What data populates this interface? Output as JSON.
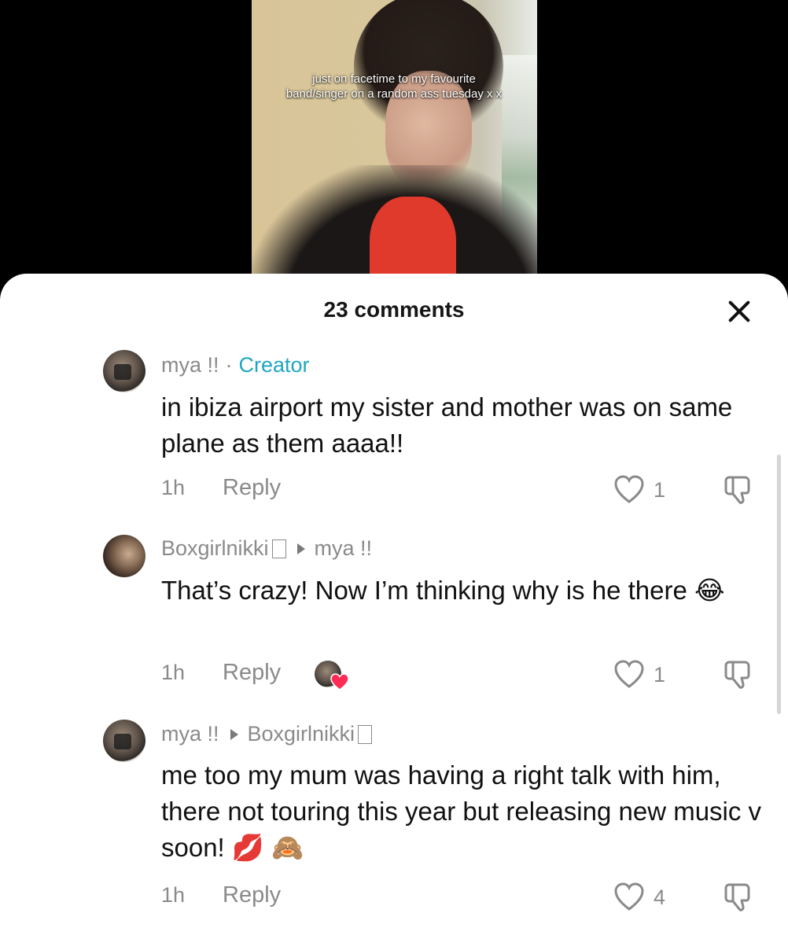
{
  "video": {
    "caption": "just on facetime to my favourite band/singer on a random ass tuesday x x"
  },
  "sheet": {
    "title": "23 comments"
  },
  "comments": [
    {
      "author": "mya !!",
      "separator": "·",
      "badge": "Creator",
      "text": "in ibiza airport my sister and mother was on same plane as them aaaa!!",
      "time": "1h",
      "reply_label": "Reply",
      "likes": "1"
    },
    {
      "author": "Boxgirlnikki",
      "reply_to": "mya !!",
      "text": "That’s crazy! Now I’m thinking why is he there 😂",
      "time": "1h",
      "reply_label": "Reply",
      "likes": "1"
    },
    {
      "author": "mya !!",
      "reply_to": "Boxgirlnikki",
      "text": "me too my mum was having a right talk with him, there not touring this year but releasing new music v soon! 💋 🙈",
      "time": "1h",
      "reply_label": "Reply",
      "likes": "4"
    }
  ],
  "colors": {
    "creator": "#20a6c4",
    "muted": "#8a8a8a",
    "heart_red": "#fe2c55"
  },
  "icons": [
    "close-icon",
    "heart-icon",
    "dislike-icon",
    "reply-arrow-icon"
  ]
}
